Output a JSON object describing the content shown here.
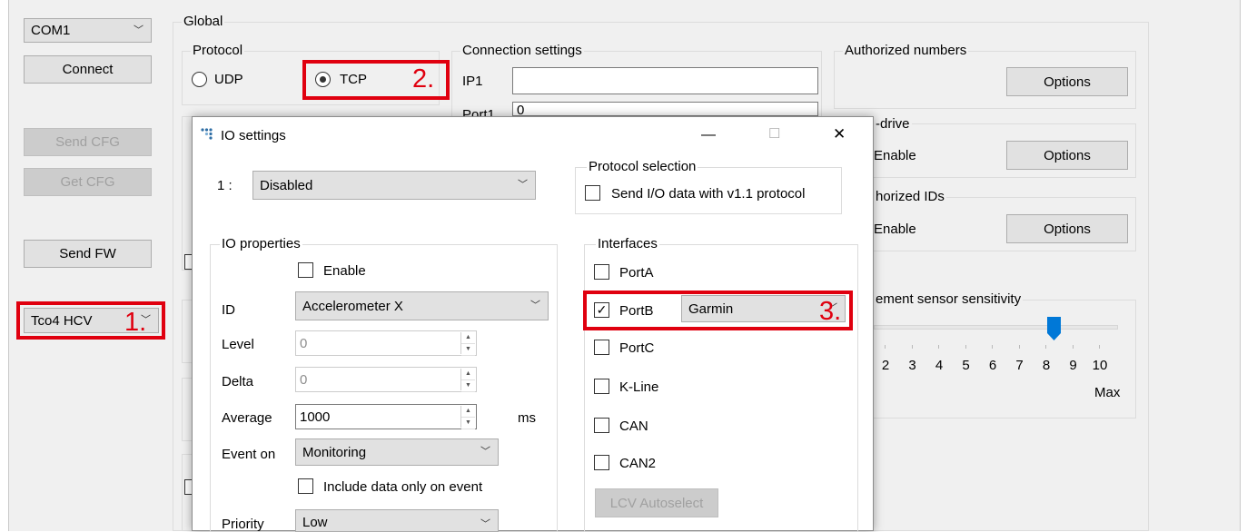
{
  "left_panel": {
    "com_port": "COM1",
    "connect": "Connect",
    "send_cfg": "Send CFG",
    "get_cfg": "Get CFG",
    "send_fw": "Send FW",
    "device": "Tco4 HCV"
  },
  "global": {
    "title": "Global",
    "protocol": {
      "title": "Protocol",
      "udp": "UDP",
      "tcp": "TCP",
      "selected": "TCP"
    },
    "connection": {
      "title": "Connection settings",
      "ip1": "IP1",
      "ip1_value": "",
      "port1": "Port1",
      "port1_value": "0"
    },
    "authorized_numbers": {
      "title": "Authorized numbers",
      "options": "Options"
    },
    "drive": {
      "title": "-drive",
      "enable": "Enable",
      "options": "Options"
    },
    "ids": {
      "title": "horized IDs",
      "enable": "Enable",
      "options": "Options"
    },
    "sensor": {
      "title": "ement sensor sensitivity",
      "ticks": [
        "2",
        "3",
        "4",
        "5",
        "6",
        "7",
        "8",
        "9",
        "10"
      ],
      "max": "Max",
      "value": 8
    }
  },
  "annotations": {
    "n1": "1.",
    "n2": "2.",
    "n3": "3."
  },
  "dialog": {
    "title": "IO settings",
    "index_label": "1 :",
    "io_select": "Disabled",
    "protocol_selection": {
      "title": "Protocol selection",
      "v11": "Send I/O data with v1.1 protocol",
      "v11_checked": false
    },
    "io_props": {
      "title": "IO properties",
      "enable": "Enable",
      "id_label": "ID",
      "id_value": "Accelerometer X",
      "level_label": "Level",
      "level_value": "0",
      "delta_label": "Delta",
      "delta_value": "0",
      "average_label": "Average",
      "average_value": "1000",
      "average_unit": "ms",
      "event_label": "Event on",
      "event_value": "Monitoring",
      "include": "Include data only on event",
      "priority_label": "Priority",
      "priority_value": "Low"
    },
    "interfaces": {
      "title": "Interfaces",
      "porta": "PortA",
      "portb": "PortB",
      "portb_device": "Garmin",
      "portc": "PortC",
      "kline": "K-Line",
      "can": "CAN",
      "can2": "CAN2",
      "lcv": "LCV Autoselect"
    }
  },
  "glyphs": {
    "check": "✓",
    "chevron": "﹀",
    "minimize": "—",
    "maximize": "☐",
    "close": "✕",
    "up": "▲",
    "down": "▼"
  }
}
